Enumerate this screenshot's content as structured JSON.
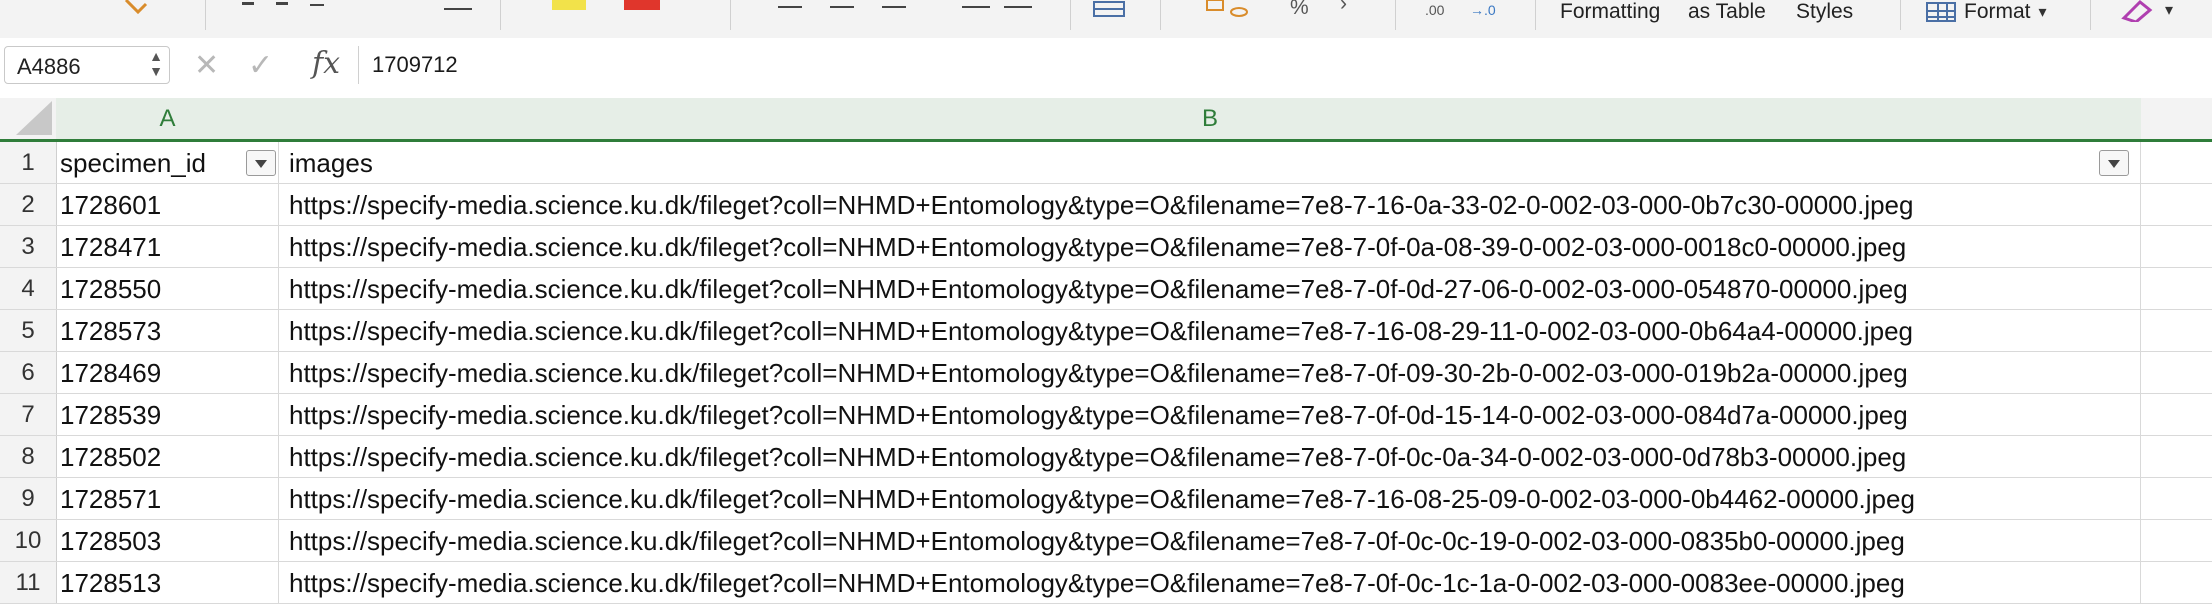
{
  "ribbon": {
    "labels": [
      "Formatting",
      "as Table",
      "Styles"
    ],
    "format_label": "Format",
    "chevron": "▾",
    "number_glyphs": {
      "percent": "%",
      "decimals_inc": ".00",
      "decimals_dec": "→.0"
    }
  },
  "formula_bar": {
    "name_box": "A4886",
    "cancel_icon": "✕",
    "enter_icon": "✓",
    "fx_label": "fx",
    "formula_value": "1709712"
  },
  "columns": [
    "A",
    "B"
  ],
  "header_row": {
    "number": "1",
    "a": "specimen_id",
    "b": "images"
  },
  "rows": [
    {
      "number": "2",
      "a": "1728601",
      "b": "https://specify-media.science.ku.dk/fileget?coll=NHMD+Entomology&type=O&filename=7e8-7-16-0a-33-02-0-002-03-000-0b7c30-00000.jpeg"
    },
    {
      "number": "3",
      "a": "1728471",
      "b": "https://specify-media.science.ku.dk/fileget?coll=NHMD+Entomology&type=O&filename=7e8-7-0f-0a-08-39-0-002-03-000-0018c0-00000.jpeg"
    },
    {
      "number": "4",
      "a": "1728550",
      "b": "https://specify-media.science.ku.dk/fileget?coll=NHMD+Entomology&type=O&filename=7e8-7-0f-0d-27-06-0-002-03-000-054870-00000.jpeg"
    },
    {
      "number": "5",
      "a": "1728573",
      "b": "https://specify-media.science.ku.dk/fileget?coll=NHMD+Entomology&type=O&filename=7e8-7-16-08-29-11-0-002-03-000-0b64a4-00000.jpeg"
    },
    {
      "number": "6",
      "a": "1728469",
      "b": "https://specify-media.science.ku.dk/fileget?coll=NHMD+Entomology&type=O&filename=7e8-7-0f-09-30-2b-0-002-03-000-019b2a-00000.jpeg"
    },
    {
      "number": "7",
      "a": "1728539",
      "b": "https://specify-media.science.ku.dk/fileget?coll=NHMD+Entomology&type=O&filename=7e8-7-0f-0d-15-14-0-002-03-000-084d7a-00000.jpeg"
    },
    {
      "number": "8",
      "a": "1728502",
      "b": "https://specify-media.science.ku.dk/fileget?coll=NHMD+Entomology&type=O&filename=7e8-7-0f-0c-0a-34-0-002-03-000-0d78b3-00000.jpeg"
    },
    {
      "number": "9",
      "a": "1728571",
      "b": "https://specify-media.science.ku.dk/fileget?coll=NHMD+Entomology&type=O&filename=7e8-7-16-08-25-09-0-002-03-000-0b4462-00000.jpeg"
    },
    {
      "number": "10",
      "a": "1728503",
      "b": "https://specify-media.science.ku.dk/fileget?coll=NHMD+Entomology&type=O&filename=7e8-7-0f-0c-0c-19-0-002-03-000-0835b0-00000.jpeg"
    },
    {
      "number": "11",
      "a": "1728513",
      "b": "https://specify-media.science.ku.dk/fileget?coll=NHMD+Entomology&type=O&filename=7e8-7-0f-0c-1c-1a-0-002-03-000-0083ee-00000.jpeg"
    }
  ],
  "colors": {
    "header_accent": "#2f7d3a",
    "ribbon_bg": "#f3f3f3"
  }
}
